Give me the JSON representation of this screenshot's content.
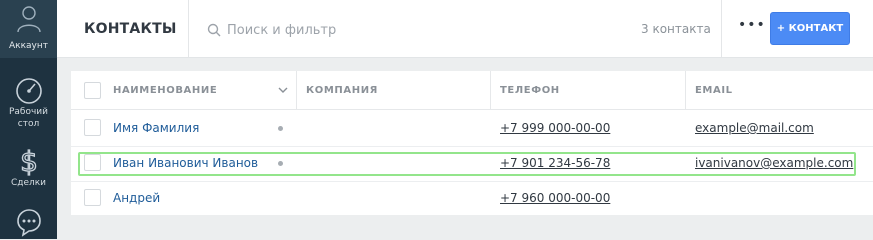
{
  "nav": {
    "account_label": "Аккаунт",
    "items": [
      {
        "label_line1": "Рабочий",
        "label_line2": "стол",
        "icon": "dashboard-icon"
      },
      {
        "label_line1": "Сделки",
        "label_line2": "",
        "icon": "dollar-icon"
      },
      {
        "label_line1": "",
        "label_line2": "",
        "icon": "chat-icon"
      }
    ]
  },
  "header": {
    "title": "КОНТАКТЫ",
    "search_placeholder": "Поиск и фильтр",
    "count": "3 контакта",
    "more": "•••",
    "add_button": "+ КОНТАКТ"
  },
  "table": {
    "columns": [
      "НАИМЕНОВАНИЕ",
      "КОМПАНИЯ",
      "ТЕЛЕФОН",
      "EMAIL"
    ],
    "rows": [
      {
        "name": "Имя Фамилия",
        "phone": "+7 999 000-00-00",
        "email": "example@mail.com"
      },
      {
        "name": "Иван Иванович Иванов",
        "phone": "+7 901 234-56-78",
        "email": "ivanivanov@example.com"
      },
      {
        "name": "Андрей",
        "phone": "+7 960 000-00-00",
        "email": ""
      }
    ]
  },
  "colors": {
    "nav_bg": "#1e3240",
    "accent": "#4c8bf5",
    "link": "#1f5c99",
    "selection_outline": "#93e58b"
  }
}
